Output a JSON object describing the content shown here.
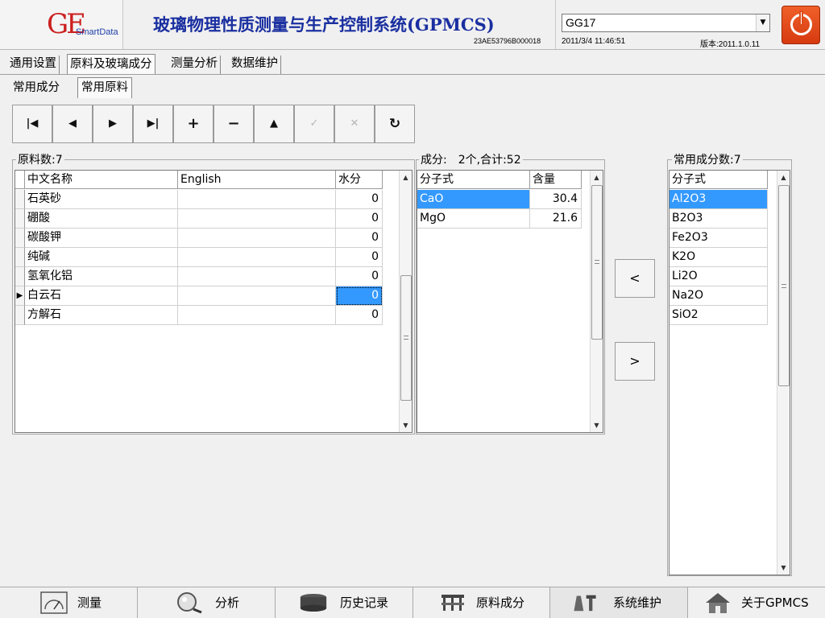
{
  "header": {
    "logo_ge": "GE",
    "logo_smartdata": "SmartData",
    "title": "玻璃物理性质测量与生产控制系统(GPMCS)",
    "serial": "23AE53796B000018",
    "config_value": "GG17",
    "datetime": "2011/3/4 11:46:51",
    "version": "版本:2011.1.0.11"
  },
  "tabs": [
    {
      "label": "通用设置"
    },
    {
      "label": "原料及玻璃成分"
    },
    {
      "label": "测量分析"
    },
    {
      "label": "数据维护"
    }
  ],
  "subtabs": [
    {
      "label": "常用成分"
    },
    {
      "label": "常用原料"
    }
  ],
  "toolbar": {
    "first": "|◀",
    "prev": "◀",
    "next": "▶",
    "last": "▶|",
    "add": "+",
    "remove": "−",
    "up": "▲",
    "confirm": "✓",
    "cancel": "✕",
    "refresh": "↻"
  },
  "materials": {
    "legend": "原料数:7",
    "columns": [
      "中文名称",
      "English",
      "水分"
    ],
    "rows": [
      {
        "name": "石英砂",
        "english": "",
        "moisture": "0"
      },
      {
        "name": "硼酸",
        "english": "",
        "moisture": "0"
      },
      {
        "name": "碳酸钾",
        "english": "",
        "moisture": "0"
      },
      {
        "name": "纯碱",
        "english": "",
        "moisture": "0"
      },
      {
        "name": "氢氧化铝",
        "english": "",
        "moisture": "0"
      },
      {
        "name": "白云石",
        "english": "",
        "moisture": "0"
      },
      {
        "name": "方解石",
        "english": "",
        "moisture": "0"
      }
    ]
  },
  "composition": {
    "legend": "成分:　2个,合计:52",
    "columns": [
      "分子式",
      "含量"
    ],
    "rows": [
      {
        "formula": "CaO",
        "amount": "30.4"
      },
      {
        "formula": "MgO",
        "amount": "21.6"
      }
    ]
  },
  "common": {
    "legend": "常用成分数:7",
    "column": "分子式",
    "rows": [
      "Al2O3",
      "B2O3",
      "Fe2O3",
      "K2O",
      "Li2O",
      "Na2O",
      "SiO2"
    ]
  },
  "move": {
    "left": "<",
    "right": ">"
  },
  "nav": [
    {
      "label": "测量",
      "icon": "gauge-icon"
    },
    {
      "label": "分析",
      "icon": "magnifier-icon"
    },
    {
      "label": "历史记录",
      "icon": "database-icon"
    },
    {
      "label": "原料成分",
      "icon": "structure-icon"
    },
    {
      "label": "系统维护",
      "icon": "tools-icon"
    },
    {
      "label": "关于GPMCS",
      "icon": "home-icon"
    }
  ],
  "colors": {
    "accent_selection": "#3399ff",
    "title_blue": "#1a2fa0",
    "logo_red": "#cc1f1f",
    "power_orange": "#e04a18"
  }
}
